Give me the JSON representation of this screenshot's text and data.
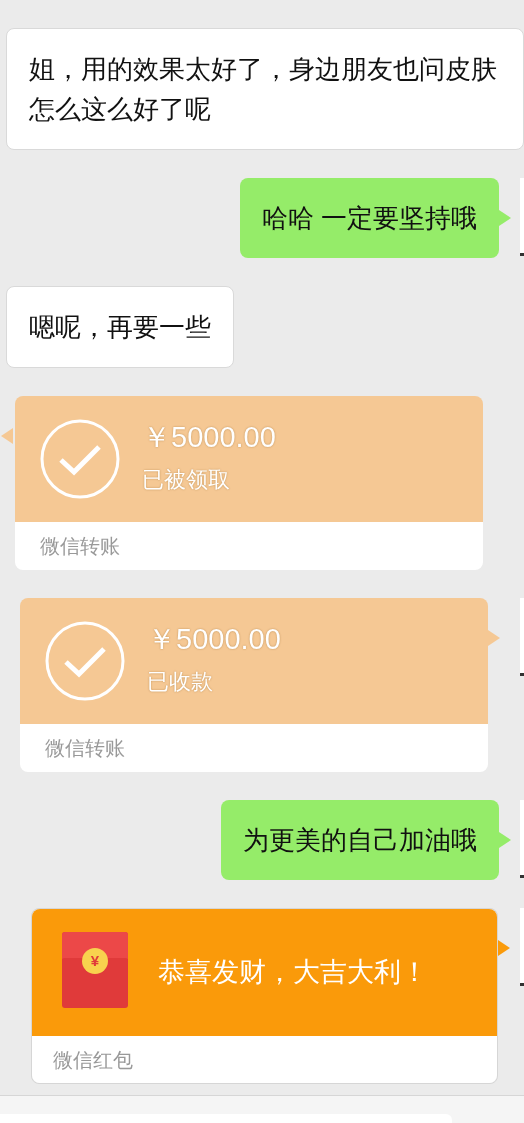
{
  "messages": [
    {
      "kind": "text",
      "outgoing": false,
      "text": "姐，用的效果太好了，身边朋友也问皮肤怎么这么好了呢"
    },
    {
      "kind": "text",
      "outgoing": true,
      "text": "哈哈 一定要坚持哦"
    },
    {
      "kind": "text",
      "outgoing": false,
      "text": "嗯呢，再要一些"
    },
    {
      "kind": "transfer",
      "outgoing": false,
      "amount": "￥5000.00",
      "status": "已被领取",
      "label": "微信转账"
    },
    {
      "kind": "transfer",
      "outgoing": true,
      "amount": "￥5000.00",
      "status": "已收款",
      "label": "微信转账"
    },
    {
      "kind": "text",
      "outgoing": true,
      "text": "为更美的自己加油哦"
    },
    {
      "kind": "red_packet",
      "outgoing": true,
      "coin": "¥",
      "greeting": "恭喜发财，大吉大利！",
      "label": "微信红包"
    }
  ]
}
